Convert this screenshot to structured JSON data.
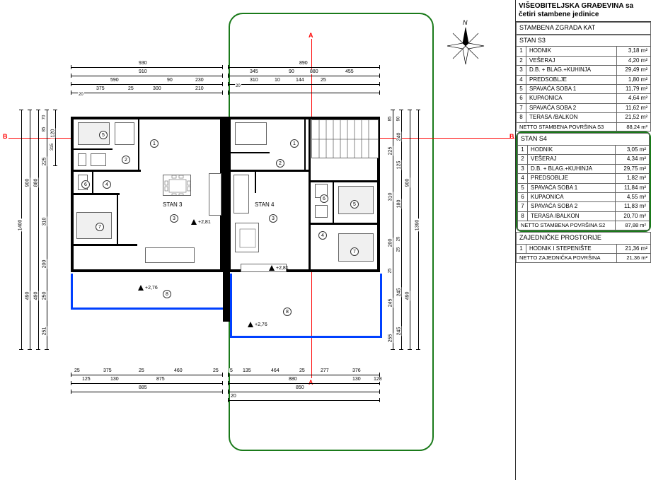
{
  "title": "VIŠEOBITELJSKA GRAĐEVINA sa četiri stambene jedinice",
  "building_header": "STAMBENA ZGRADA KAT",
  "section_marks": {
    "A": "A",
    "B": "B"
  },
  "compass_n": "N",
  "stan_labels": {
    "s3": "STAN 3",
    "s4": "STAN 4"
  },
  "elevations": {
    "a": "+2,81",
    "b": "+2,81",
    "c": "+2,76",
    "d": "+2,76"
  },
  "stan_s3": {
    "header": "STAN S3",
    "rows": [
      {
        "n": "1",
        "name": "HODNIK",
        "area": "3,18 m²"
      },
      {
        "n": "2",
        "name": "VEŠERAJ",
        "area": "4,20 m²"
      },
      {
        "n": "3",
        "name": "D.B. + BLAG.+KUHINJA",
        "area": "29,49 m²"
      },
      {
        "n": "4",
        "name": "PREDSOBLJE",
        "area": "1,80 m²"
      },
      {
        "n": "5",
        "name": "SPAVAĆA SOBA 1",
        "area": "11,79 m²"
      },
      {
        "n": "6",
        "name": "KUPAONICA",
        "area": "4,64 m²"
      },
      {
        "n": "7",
        "name": "SPAVAĆA SOBA 2",
        "area": "11,62 m²"
      },
      {
        "n": "8",
        "name": "TERASA /BALKON",
        "area": "21,52 m²"
      }
    ],
    "total_label": "NETTO STAMBENA POVRŠINA S3",
    "total_area": "88,24 m²"
  },
  "stan_s4": {
    "header": "STAN S4",
    "rows": [
      {
        "n": "1",
        "name": "HODNIK",
        "area": "3,05 m²"
      },
      {
        "n": "2",
        "name": "VEŠERAJ",
        "area": "4,34 m²"
      },
      {
        "n": "3",
        "name": "D.B. + BLAG.+KUHINJA",
        "area": "29,75 m²"
      },
      {
        "n": "4",
        "name": "PREDSOBLJE",
        "area": "1,82 m²"
      },
      {
        "n": "5",
        "name": "SPAVAĆA SOBA 1",
        "area": "11,84 m²"
      },
      {
        "n": "6",
        "name": "KUPAONICA",
        "area": "4,55 m²"
      },
      {
        "n": "7",
        "name": "SPAVAĆA SOBA 2",
        "area": "11,83 m²"
      },
      {
        "n": "8",
        "name": "TERASA /BALKON",
        "area": "20,70 m²"
      }
    ],
    "total_label": "NETTO STAMBENA POVRŠINA S2",
    "total_area": "87,88 m²"
  },
  "zajednicke": {
    "header": "ZAJEDNIČKE PROSTORIJE",
    "rows": [
      {
        "n": "1",
        "name": "HODNIK I STEPENIŠTE",
        "area": "21,36 m²"
      }
    ],
    "total_label": "NETTO ZAJEDNIČKA POVRŠINA",
    "total_area": "21,36 m²"
  },
  "dims_top": {
    "row1": [
      {
        "v": "930"
      }
    ],
    "row2": [
      {
        "v": "910"
      }
    ],
    "row3": [
      {
        "v": "590"
      },
      {
        "v": "90"
      },
      {
        "v": "230"
      }
    ],
    "row4": [
      {
        "v": "375"
      },
      {
        "v": "25"
      },
      {
        "v": "300"
      },
      {
        "v": "210"
      }
    ],
    "row1b": [
      {
        "v": "20"
      }
    ],
    "row2b": [
      {
        "v": "20"
      }
    ],
    "row3c": [
      {
        "v": "890"
      }
    ],
    "row4c": [
      {
        "v": "345"
      },
      {
        "v": "90"
      },
      {
        "v": "880"
      },
      {
        "v": "455"
      }
    ],
    "row5c": [
      {
        "v": "310"
      },
      {
        "v": "10"
      },
      {
        "v": "144"
      },
      {
        "v": "25"
      },
      {
        "v": ""
      }
    ]
  },
  "dims_bottom": {
    "row1": [
      {
        "v": "25"
      },
      {
        "v": "375"
      },
      {
        "v": "25"
      },
      {
        "v": "460"
      },
      {
        "v": "25"
      }
    ],
    "row2": [
      {
        "v": "125"
      },
      {
        "v": "130"
      },
      {
        "v": "875"
      },
      {
        "v": ""
      },
      {
        "v": ""
      }
    ],
    "row3": [
      {
        "v": "885"
      }
    ],
    "row1b": [
      {
        "v": "5"
      },
      {
        "v": "135"
      },
      {
        "v": "464"
      },
      {
        "v": "25"
      },
      {
        "v": "277"
      },
      {
        "v": "376"
      }
    ],
    "row2b": [
      {
        "v": "880"
      },
      {
        "v": "130"
      },
      {
        "v": "128"
      }
    ],
    "row3b": [
      {
        "v": "850"
      }
    ],
    "row4b": [
      {
        "v": "20"
      }
    ]
  },
  "dims_left": {
    "col1": [
      {
        "v": "1400"
      }
    ],
    "col2": [
      {
        "v": "900"
      },
      {
        "v": "490"
      }
    ],
    "col3": [
      {
        "v": "880"
      },
      {
        "v": "490"
      }
    ],
    "col4": [
      {
        "v": "70"
      },
      {
        "v": "85"
      },
      {
        "v": "225"
      },
      {
        "v": "310"
      },
      {
        "v": "200"
      },
      {
        "v": "250"
      },
      {
        "v": "251"
      }
    ],
    "col5": [
      {
        "v": "120"
      },
      {
        "v": "315"
      }
    ]
  },
  "dims_right": {
    "col1": [
      {
        "v": "85"
      },
      {
        "v": "225"
      },
      {
        "v": "310"
      },
      {
        "v": "200"
      },
      {
        "v": "25"
      },
      {
        "v": "245"
      },
      {
        "v": "255"
      }
    ],
    "col2": [
      {
        "v": "90"
      },
      {
        "v": "240"
      },
      {
        "v": "125"
      },
      {
        "v": "180"
      },
      {
        "v": "25"
      },
      {
        "v": "25"
      },
      {
        "v": "245"
      },
      {
        "v": "245"
      }
    ],
    "col3": [
      {
        "v": "900"
      },
      {
        "v": "490"
      }
    ],
    "col4": [
      {
        "v": "1390"
      }
    ]
  },
  "room_markers_left": [
    "1",
    "2",
    "3",
    "4",
    "5",
    "6",
    "7",
    "8"
  ],
  "room_markers_right": [
    "1",
    "2",
    "3",
    "4",
    "5",
    "6",
    "7",
    "8"
  ]
}
